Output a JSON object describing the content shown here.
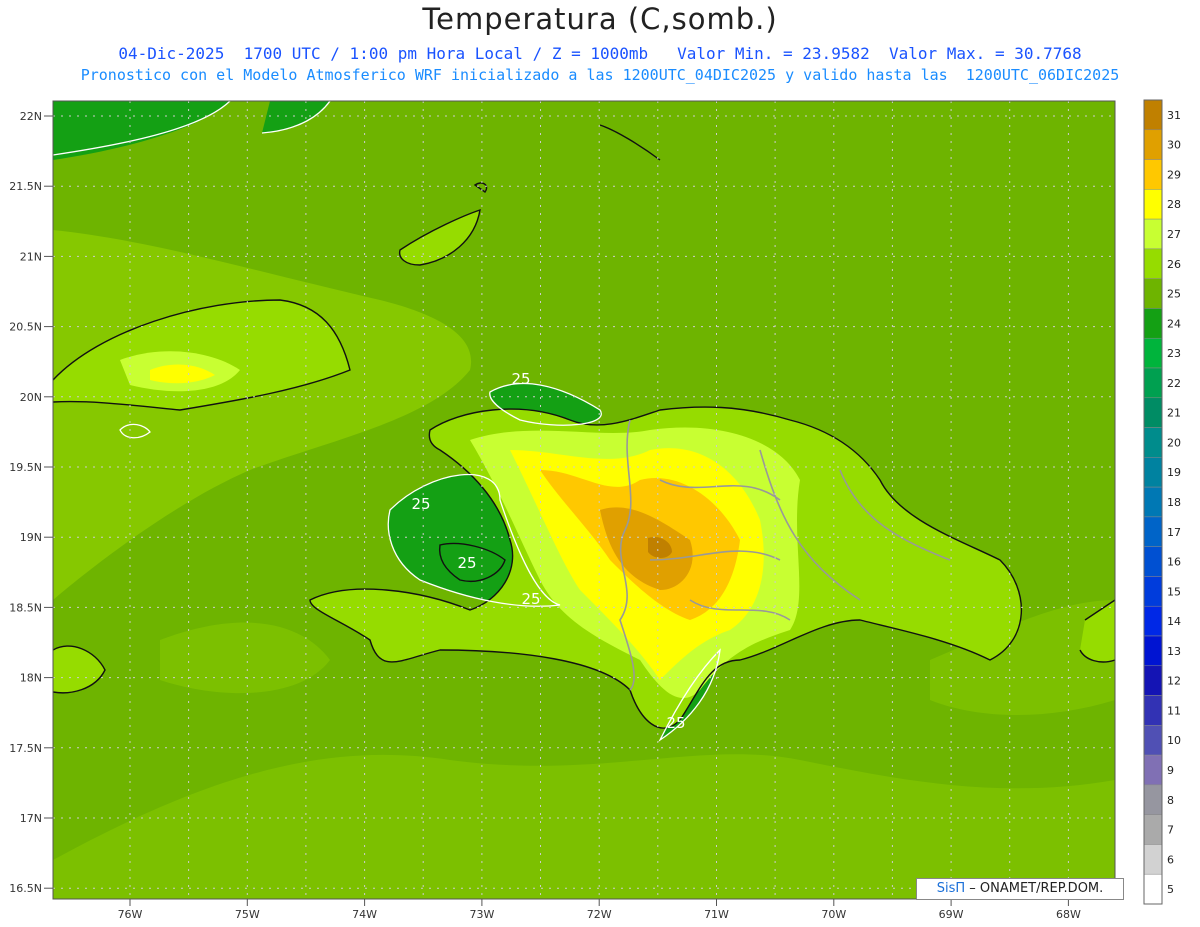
{
  "title": "Temperatura (C,somb.)",
  "subtitle1": "04-Dic-2025  1700 UTC / 1:00 pm Hora Local / Z = 1000mb   Valor Min. = 23.9582  Valor Max. = 30.7768",
  "subtitle2": "Pronostico con el Modelo Atmosferico WRF inicializado a las 1200UTC_04DIC2025 y valido hasta las  1200UTC_06DIC2025",
  "footer": {
    "brand": "SisΠ",
    "text": " – ONAMET/REP.DOM."
  },
  "lat_labels": [
    "22N",
    "21.5N",
    "21N",
    "20.5N",
    "20N",
    "19.5N",
    "19N",
    "18.5N",
    "18N",
    "17.5N",
    "17N",
    "16.5N"
  ],
  "lon_labels": [
    "76W",
    "75W",
    "74W",
    "73W",
    "72W",
    "71W",
    "70W",
    "69W",
    "68W"
  ],
  "contour_labels": [
    "25",
    "25",
    "25",
    "25",
    "25"
  ],
  "colorbar": [
    {
      "v": "31",
      "c": "#c08000"
    },
    {
      "v": "30",
      "c": "#e0a000"
    },
    {
      "v": "29",
      "c": "#ffc800"
    },
    {
      "v": "28",
      "c": "#ffff00"
    },
    {
      "v": "27",
      "c": "#c8ff32"
    },
    {
      "v": "26",
      "c": "#96dc00"
    },
    {
      "v": "25",
      "c": "#6eb400"
    },
    {
      "v": "24",
      "c": "#14a014"
    },
    {
      "v": "23",
      "c": "#00b43c"
    },
    {
      "v": "22",
      "c": "#00a050"
    },
    {
      "v": "21",
      "c": "#008c64"
    },
    {
      "v": "20",
      "c": "#008c8c"
    },
    {
      "v": "19",
      "c": "#0082a0"
    },
    {
      "v": "18",
      "c": "#0078b4"
    },
    {
      "v": "17",
      "c": "#0064c8"
    },
    {
      "v": "16",
      "c": "#0050d2"
    },
    {
      "v": "15",
      "c": "#003cdc"
    },
    {
      "v": "14",
      "c": "#0028e6"
    },
    {
      "v": "13",
      "c": "#0014d2"
    },
    {
      "v": "12",
      "c": "#1414b4"
    },
    {
      "v": "11",
      "c": "#3232b4"
    },
    {
      "v": "10",
      "c": "#5050b4"
    },
    {
      "v": "9",
      "c": "#8070b4"
    },
    {
      "v": "8",
      "c": "#9696a0"
    },
    {
      "v": "7",
      "c": "#aaaaaa"
    },
    {
      "v": "6",
      "c": "#d2d2d2"
    },
    {
      "v": "5",
      "c": "#ffffff"
    }
  ]
}
